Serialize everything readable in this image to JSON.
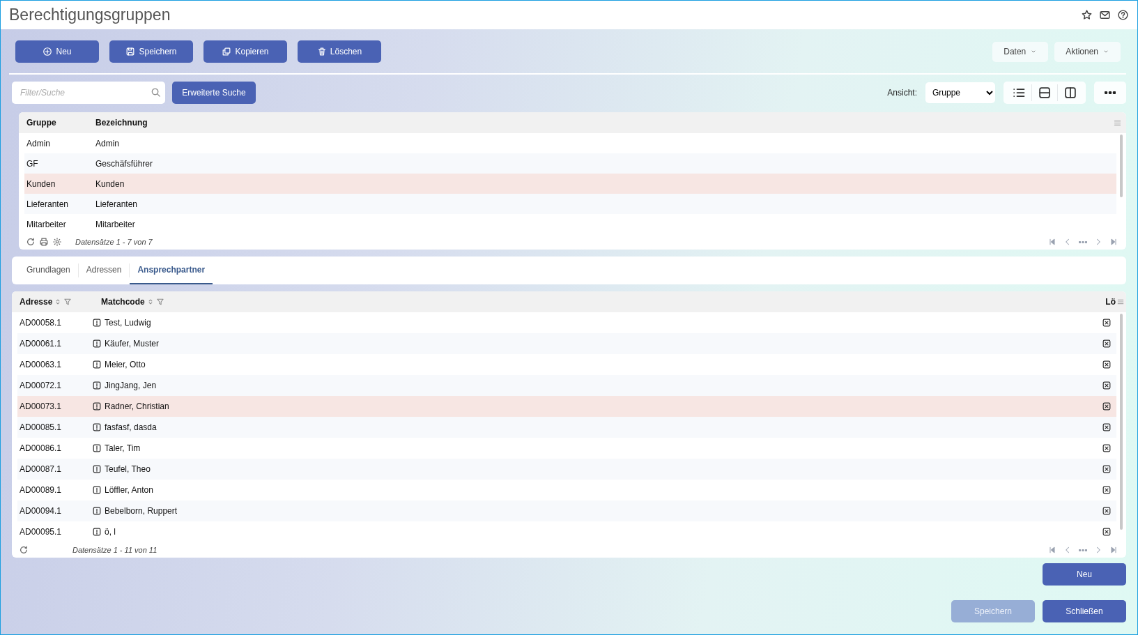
{
  "window": {
    "title": "Berechtigungsgruppen"
  },
  "toolbar": {
    "buttons": [
      {
        "label": "Neu",
        "kind": "plus"
      },
      {
        "label": "Speichern",
        "kind": "save"
      },
      {
        "label": "Kopieren",
        "kind": "copy"
      },
      {
        "label": "Löschen",
        "kind": "trash"
      }
    ],
    "menus": [
      "Daten",
      "Aktionen"
    ]
  },
  "search": {
    "placeholder": "Filter/Suche",
    "advanced_button": "Erweiterte Suche",
    "view_label": "Ansicht:",
    "view_value": "Gruppe"
  },
  "groups_table": {
    "columns": [
      "Gruppe",
      "Bezeichnung"
    ],
    "rows": [
      {
        "cells": [
          "Admin",
          "Admin"
        ],
        "selected": false
      },
      {
        "cells": [
          "GF",
          "Geschäfsführer"
        ],
        "selected": false
      },
      {
        "cells": [
          "Kunden",
          "Kunden"
        ],
        "selected": true
      },
      {
        "cells": [
          "Lieferanten",
          "Lieferanten"
        ],
        "selected": false
      },
      {
        "cells": [
          "Mitarbeiter",
          "Mitarbeiter"
        ],
        "selected": false
      }
    ],
    "footer": "Datensätze 1 - 7 von 7"
  },
  "tabs": [
    {
      "label": "Grundlagen",
      "selected": false
    },
    {
      "label": "Adressen",
      "selected": false
    },
    {
      "label": "Ansprechpartner",
      "selected": true
    }
  ],
  "contacts_table": {
    "columns": [
      "Adresse",
      "Matchcode",
      "Lö"
    ],
    "rows": [
      {
        "address": "AD00058.1",
        "matchcode": "Test, Ludwig",
        "selected": false
      },
      {
        "address": "AD00061.1",
        "matchcode": "Käufer, Muster",
        "selected": false
      },
      {
        "address": "AD00063.1",
        "matchcode": "Meier, Otto",
        "selected": false
      },
      {
        "address": "AD00072.1",
        "matchcode": "JingJang, Jen",
        "selected": false
      },
      {
        "address": "AD00073.1",
        "matchcode": "Radner, Christian",
        "selected": true
      },
      {
        "address": "AD00085.1",
        "matchcode": "fasfasf, dasda",
        "selected": false
      },
      {
        "address": "AD00086.1",
        "matchcode": "Taler, Tim",
        "selected": false
      },
      {
        "address": "AD00087.1",
        "matchcode": "Teufel, Theo",
        "selected": false
      },
      {
        "address": "AD00089.1",
        "matchcode": "Löffler, Anton",
        "selected": false
      },
      {
        "address": "AD00094.1",
        "matchcode": "Bebelborn, Ruppert",
        "selected": false
      },
      {
        "address": "AD00095.1",
        "matchcode": "ö, l",
        "selected": false
      }
    ],
    "footer": "Datensätze 1 - 11 von 11"
  },
  "actions": {
    "new_button": "Neu",
    "buttons": [
      {
        "label": "Speichern",
        "disabled": true
      },
      {
        "label": "Schließen",
        "disabled": false
      }
    ]
  }
}
